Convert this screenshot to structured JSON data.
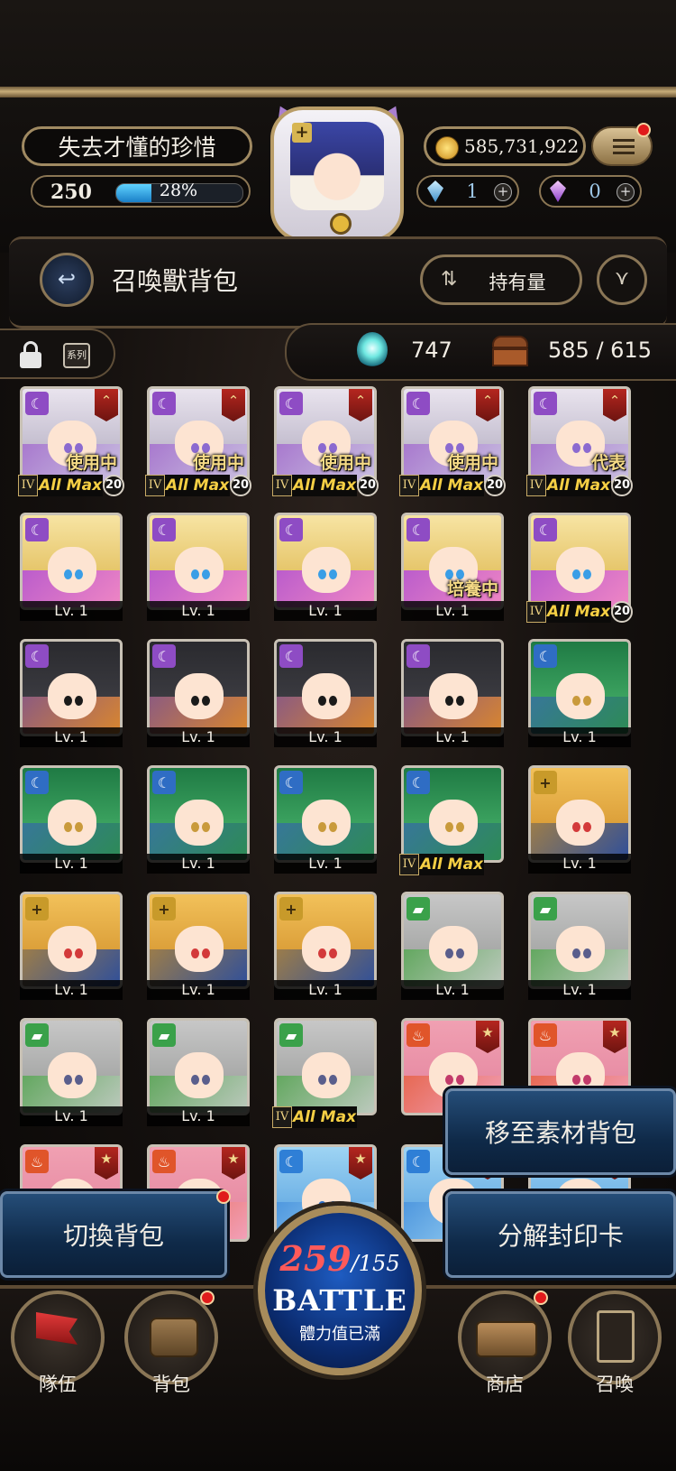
{
  "header": {
    "player_name": "失去才懂的珍惜",
    "level": "250",
    "exp_text": "28%",
    "exp_fraction": 0.28,
    "coins": "585,731,922",
    "gem_blue": "1",
    "gem_purple": "0",
    "plus": "+"
  },
  "title": {
    "back_icon": "↩",
    "text": "召喚獸背包",
    "sort_icon": "⇅",
    "sort_label": "持有量",
    "filter_icon": "⋎"
  },
  "info": {
    "series_label": "系列",
    "spirit_count": "747",
    "capacity": "585 / 615"
  },
  "cards": [
    {
      "theme": "emilia",
      "attr": "☾",
      "rank": "⌃",
      "status": "使用中",
      "tier": "IV",
      "allmax": "All Max",
      "mx": "20"
    },
    {
      "theme": "emilia",
      "attr": "☾",
      "rank": "⌃",
      "status": "使用中",
      "tier": "IV",
      "allmax": "All Max",
      "mx": "20"
    },
    {
      "theme": "emilia",
      "attr": "☾",
      "rank": "⌃",
      "status": "使用中",
      "tier": "IV",
      "allmax": "All Max",
      "mx": "20"
    },
    {
      "theme": "emilia",
      "attr": "☾",
      "rank": "⌃",
      "status": "使用中",
      "tier": "IV",
      "allmax": "All Max",
      "mx": "20"
    },
    {
      "theme": "emilia",
      "attr": "☾",
      "rank": "⌃",
      "status": "代表",
      "tier": "IV",
      "allmax": "All Max",
      "mx": "20"
    },
    {
      "theme": "beatrice",
      "attr": "☾",
      "lv": "Lv. 1"
    },
    {
      "theme": "beatrice",
      "attr": "☾",
      "lv": "Lv. 1"
    },
    {
      "theme": "beatrice",
      "attr": "☾",
      "lv": "Lv. 1"
    },
    {
      "theme": "beatrice",
      "attr": "☾",
      "status": "培養中",
      "lv": "Lv. 1"
    },
    {
      "theme": "beatrice",
      "attr": "☾",
      "tier": "IV",
      "allmax": "All Max",
      "mx": "20"
    },
    {
      "theme": "subaru",
      "attr": "☾",
      "lv": "Lv. 1"
    },
    {
      "theme": "subaru",
      "attr": "☾",
      "lv": "Lv. 1"
    },
    {
      "theme": "subaru",
      "attr": "☾",
      "lv": "Lv. 1"
    },
    {
      "theme": "subaru",
      "attr": "☾",
      "lv": "Lv. 1"
    },
    {
      "theme": "twins",
      "attr": "☾",
      "lv": "Lv. 1"
    },
    {
      "theme": "twins",
      "attr": "☾",
      "lv": "Lv. 1"
    },
    {
      "theme": "twins",
      "attr": "☾",
      "lv": "Lv. 1"
    },
    {
      "theme": "twins",
      "attr": "☾",
      "lv": "Lv. 1"
    },
    {
      "theme": "twins",
      "attr": "☾",
      "tier": "IV",
      "allmax": "All Max"
    },
    {
      "theme": "felt",
      "attr": "+",
      "lv": "Lv. 1"
    },
    {
      "theme": "felt",
      "attr": "+",
      "lv": "Lv. 1"
    },
    {
      "theme": "felt",
      "attr": "+",
      "lv": "Lv. 1"
    },
    {
      "theme": "felt",
      "attr": "+",
      "lv": "Lv. 1"
    },
    {
      "theme": "wilhelm",
      "attr": "▰",
      "lv": "Lv. 1"
    },
    {
      "theme": "wilhelm",
      "attr": "▰",
      "lv": "Lv. 1"
    },
    {
      "theme": "wilhelm",
      "attr": "▰",
      "lv": "Lv. 1"
    },
    {
      "theme": "wilhelm",
      "attr": "▰",
      "lv": "Lv. 1"
    },
    {
      "theme": "wilhelm",
      "attr": "▰",
      "tier": "IV",
      "allmax": "All Max"
    },
    {
      "theme": "fire",
      "attr": "♨",
      "rank": "★"
    },
    {
      "theme": "fire",
      "attr": "♨",
      "rank": "★"
    },
    {
      "theme": "fire",
      "attr": "♨",
      "rank": "★"
    },
    {
      "theme": "fire",
      "attr": "♨",
      "rank": "★"
    },
    {
      "theme": "water",
      "attr": "☾",
      "rank": "★"
    },
    {
      "theme": "water",
      "attr": "☾",
      "rank": "★"
    },
    {
      "theme": "water",
      "attr": "☾",
      "rank": "★"
    }
  ],
  "buttons": {
    "move_material": "移至素材背包",
    "switch_bag": "切換背包",
    "decompose": "分解封印卡"
  },
  "battle": {
    "stamina_current": "259",
    "stamina_max": "/155",
    "label": "BATTLE",
    "sub": "體力值已滿"
  },
  "nav": {
    "team": "隊伍",
    "bag": "背包",
    "shop": "商店",
    "summon": "召喚"
  },
  "colors": {
    "accent_gold": "#c7ad79",
    "button_blue": "#254d78",
    "stamina_red": "#ff5a5a",
    "allmax_yellow": "#f5cf44"
  }
}
